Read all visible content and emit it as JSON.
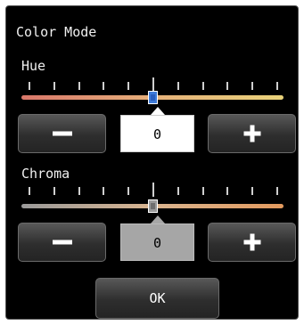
{
  "window": {
    "title": "Color Mode"
  },
  "hue": {
    "label": "Hue",
    "value": "0",
    "slider_position": 0.5,
    "gradient": [
      "#d9776a",
      "#e6b07a",
      "#e8d27a"
    ],
    "thumb_color": "#3f7bd8",
    "box_background": "#ffffff",
    "decrease_icon": "minus-icon",
    "increase_icon": "plus-icon"
  },
  "chroma": {
    "label": "Chroma",
    "value": "0",
    "slider_position": 0.5,
    "gradient": [
      "#9a9a9a",
      "#d9b48f",
      "#e39a5e"
    ],
    "thumb_color": "#9a9a9a",
    "box_background": "#a6a6a6",
    "decrease_icon": "minus-icon",
    "increase_icon": "plus-icon"
  },
  "actions": {
    "ok_label": "OK"
  }
}
